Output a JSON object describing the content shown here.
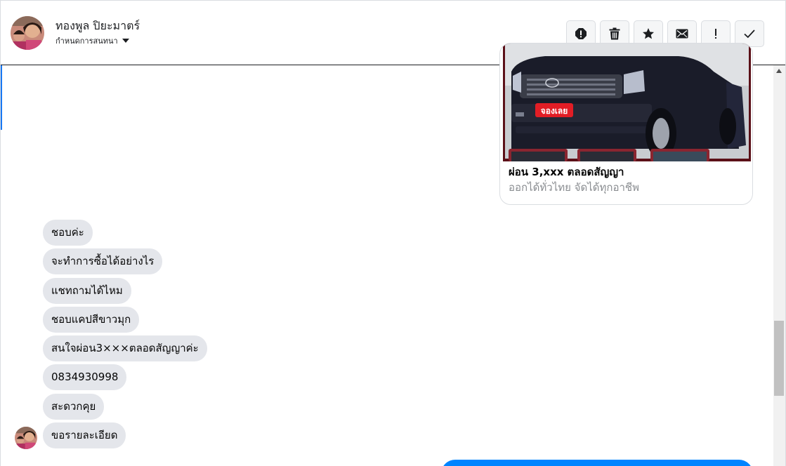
{
  "header": {
    "name": "ทองพูล ปิยะมาตร์",
    "subtitle": "กำหนดการสนทนา",
    "tools": [
      {
        "icon": "report-icon",
        "label": "Report"
      },
      {
        "icon": "trash-icon",
        "label": "Delete"
      },
      {
        "icon": "star-icon",
        "label": "Star"
      },
      {
        "icon": "mail-icon",
        "label": "Mark unread"
      },
      {
        "icon": "exclamation-icon",
        "label": "Important"
      },
      {
        "icon": "check-icon",
        "label": "Done"
      }
    ]
  },
  "shared_card": {
    "title": "ผ่อน 3,xxx ตลอดสัญญา",
    "subtitle": "ออกได้ทั่วไทย จัดได้ทุกอาชีพ",
    "badge": "จองเลย"
  },
  "messages": [
    "ชอบค่ะ",
    "จะทำการซื้อได้อย่างไร",
    "แชทถามได้ไหม",
    "ชอบแคปสีขาวมุก",
    "สนใจผ่อน3×××ตลอดสัญญาค่ะ",
    "0834930998",
    "สะดวกคุย",
    "ขอรายละเอียด"
  ],
  "colors": {
    "accent": "#1877f2",
    "bubble_gray": "#e4e6eb",
    "bubble_blue": "#0084ff"
  }
}
